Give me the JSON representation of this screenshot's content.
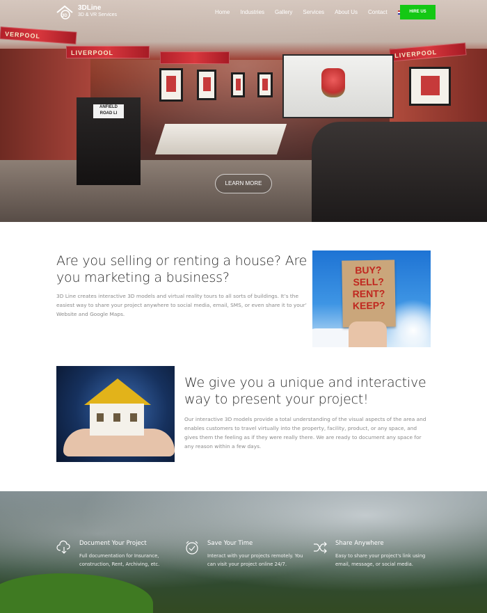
{
  "brand": {
    "name": "3DLine",
    "tagline": "3D & VR Services"
  },
  "nav": {
    "items": [
      "Home",
      "Industries",
      "Gallery",
      "Services",
      "About Us",
      "Contact"
    ],
    "language": "En",
    "hire_label": "HIRE US"
  },
  "hero": {
    "cta_label": "LEARN MORE",
    "banner_texts": [
      "VERPOOL",
      "LIVERPOOL",
      "LIVERPOOL",
      "LIVERPOOL"
    ],
    "bar_sign": "ANFIELD ROAD LI"
  },
  "section1": {
    "title": "Are you selling or renting a house? Are you marketing a business?",
    "body": "3D Line creates interactive 3D models and virtual reality tours to all sorts of buildings. It’s the easiest way to share your project anywhere to social media, email, SMS, or even share it to your’ Website and Google Maps.",
    "image_sign": [
      "BUY?",
      "SELL?",
      "RENT?",
      "KEEP?"
    ]
  },
  "section2": {
    "title": "We give you a unique and interactive way to present your project!",
    "body": "Our interactive 3D models provide a total understanding of the visual aspects of the area and enables customers to travel virtually into the property, facility, product, or any space, and gives them the feeling as if they were really there. We are ready to document any space for any reason within a few days."
  },
  "features": [
    {
      "icon": "cloud-download-icon",
      "title": "Document Your Project",
      "desc": "Full documentation for Insurance, construction, Rent, Archiving, etc."
    },
    {
      "icon": "clock-icon",
      "title": "Save Your Time",
      "desc": "Interact with your projects remotely. You can visit your project online 24/7."
    },
    {
      "icon": "shuffle-icon",
      "title": "Share Anywhere",
      "desc": "Easy to share your project's link using email, message, or social media."
    }
  ],
  "colors": {
    "hire_button": "#14c814",
    "heading": "#2b2b2b",
    "body_text": "#8a8a8a"
  }
}
